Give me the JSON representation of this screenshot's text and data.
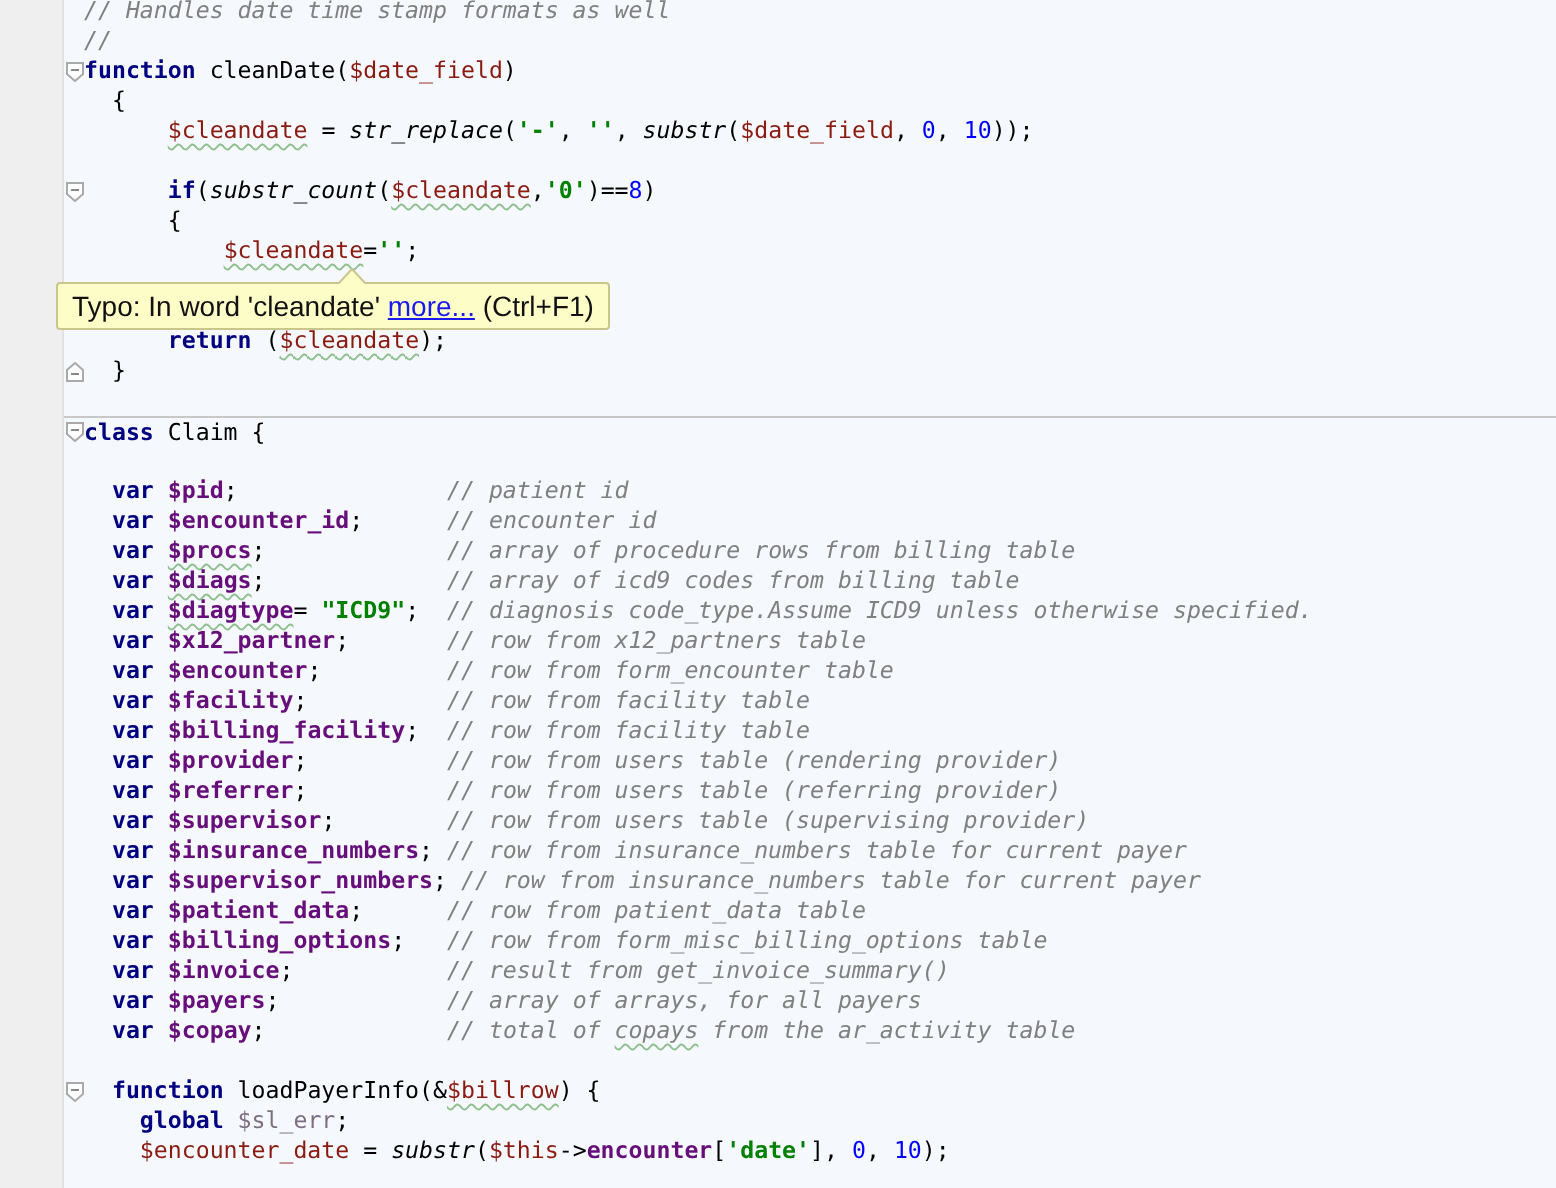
{
  "editor": {
    "lines": [
      {
        "kind": "code",
        "tokens": [
          {
            "kind": "comment",
            "text": "// Handles date time stamp formats as well"
          }
        ]
      },
      {
        "kind": "code",
        "tokens": [
          {
            "kind": "comment",
            "text": "//"
          }
        ]
      },
      {
        "kind": "fold-start",
        "tokens": [
          {
            "kind": "keyword",
            "text": "function"
          },
          {
            "kind": "text",
            "text": " cleanDate("
          },
          {
            "kind": "local",
            "text": "$date_field"
          },
          {
            "kind": "text",
            "text": ")"
          }
        ]
      },
      {
        "kind": "code",
        "tokens": [
          {
            "kind": "text",
            "text": "  {"
          }
        ]
      },
      {
        "kind": "code",
        "tokens": [
          {
            "kind": "local-typo",
            "text": "      $cleandate"
          },
          {
            "kind": "text",
            "text": " = "
          },
          {
            "kind": "call",
            "text": "str_replace"
          },
          {
            "kind": "text",
            "text": "("
          },
          {
            "kind": "string",
            "text": "'-'"
          },
          {
            "kind": "text",
            "text": ", "
          },
          {
            "kind": "string",
            "text": "''"
          },
          {
            "kind": "text",
            "text": ", "
          },
          {
            "kind": "call",
            "text": "substr"
          },
          {
            "kind": "text",
            "text": "("
          },
          {
            "kind": "local",
            "text": "$date_field"
          },
          {
            "kind": "text",
            "text": ", "
          },
          {
            "kind": "number",
            "text": "0"
          },
          {
            "kind": "text",
            "text": ", "
          },
          {
            "kind": "number",
            "text": "10"
          },
          {
            "kind": "text",
            "text": "));"
          }
        ]
      },
      {
        "kind": "blank"
      },
      {
        "kind": "fold-start",
        "tokens": [
          {
            "kind": "keyword",
            "text": "      if"
          },
          {
            "kind": "text",
            "text": "("
          },
          {
            "kind": "call",
            "text": "substr_count"
          },
          {
            "kind": "text",
            "text": "("
          },
          {
            "kind": "local-typo",
            "text": "$cleandate"
          },
          {
            "kind": "text",
            "text": ","
          },
          {
            "kind": "string",
            "text": "'0'"
          },
          {
            "kind": "text",
            "text": ")=="
          },
          {
            "kind": "number",
            "text": "8"
          },
          {
            "kind": "text",
            "text": ")"
          }
        ]
      },
      {
        "kind": "code",
        "tokens": [
          {
            "kind": "text",
            "text": "      {"
          }
        ]
      },
      {
        "kind": "code",
        "tokens": [
          {
            "kind": "local-typo",
            "text": "          $cleandate"
          },
          {
            "kind": "text",
            "text": "="
          },
          {
            "kind": "string",
            "text": "''"
          },
          {
            "kind": "text",
            "text": ";"
          }
        ]
      },
      {
        "kind": "blank"
      },
      {
        "kind": "blank"
      },
      {
        "kind": "code",
        "tokens": [
          {
            "kind": "keyword",
            "text": "      return"
          },
          {
            "kind": "text",
            "text": " ("
          },
          {
            "kind": "local-typo",
            "text": "$cleandate"
          },
          {
            "kind": "text",
            "text": ");"
          }
        ]
      },
      {
        "kind": "fold-end",
        "tokens": [
          {
            "kind": "text",
            "text": "  }"
          }
        ]
      },
      {
        "kind": "blank"
      },
      {
        "kind": "fold-start",
        "separator_above": true,
        "tokens": [
          {
            "kind": "keyword",
            "text": "class"
          },
          {
            "kind": "text",
            "text": " Claim {"
          }
        ]
      },
      {
        "kind": "blank"
      },
      {
        "kind": "code",
        "tokens": [
          {
            "kind": "keyword",
            "text": "  var"
          },
          {
            "kind": "field",
            "text": " $pid"
          },
          {
            "kind": "text",
            "text": ";"
          },
          {
            "kind": "comment",
            "text": "               // patient id"
          }
        ]
      },
      {
        "kind": "code",
        "tokens": [
          {
            "kind": "keyword",
            "text": "  var"
          },
          {
            "kind": "field",
            "text": " $encounter_id"
          },
          {
            "kind": "text",
            "text": ";"
          },
          {
            "kind": "comment",
            "text": "      // encounter id"
          }
        ]
      },
      {
        "kind": "code",
        "tokens": [
          {
            "kind": "keyword",
            "text": "  var"
          },
          {
            "kind": "field-typo",
            "text": " $procs"
          },
          {
            "kind": "text",
            "text": ";"
          },
          {
            "kind": "comment",
            "text": "             // array of procedure rows from billing table"
          }
        ]
      },
      {
        "kind": "code",
        "tokens": [
          {
            "kind": "keyword",
            "text": "  var"
          },
          {
            "kind": "field-typo",
            "text": " $diags"
          },
          {
            "kind": "text",
            "text": ";"
          },
          {
            "kind": "comment",
            "text": "             // array of icd9 codes from billing table"
          }
        ]
      },
      {
        "kind": "code",
        "tokens": [
          {
            "kind": "keyword",
            "text": "  var"
          },
          {
            "kind": "field-typo",
            "text": " $diagtype"
          },
          {
            "kind": "text",
            "text": "="
          },
          {
            "kind": "string",
            "text": " \"ICD9\""
          },
          {
            "kind": "text",
            "text": ";"
          },
          {
            "kind": "comment",
            "text": "  // diagnosis code_type.Assume ICD9 unless otherwise specified."
          }
        ]
      },
      {
        "kind": "code",
        "tokens": [
          {
            "kind": "keyword",
            "text": "  var"
          },
          {
            "kind": "field",
            "text": " $x12_partner"
          },
          {
            "kind": "text",
            "text": ";"
          },
          {
            "kind": "comment",
            "text": "       // row from x12_partners table"
          }
        ]
      },
      {
        "kind": "code",
        "tokens": [
          {
            "kind": "keyword",
            "text": "  var"
          },
          {
            "kind": "field",
            "text": " $encounter"
          },
          {
            "kind": "text",
            "text": ";"
          },
          {
            "kind": "comment",
            "text": "         // row from form_encounter table"
          }
        ]
      },
      {
        "kind": "code",
        "tokens": [
          {
            "kind": "keyword",
            "text": "  var"
          },
          {
            "kind": "field",
            "text": " $facility"
          },
          {
            "kind": "text",
            "text": ";"
          },
          {
            "kind": "comment",
            "text": "          // row from facility table"
          }
        ]
      },
      {
        "kind": "code",
        "tokens": [
          {
            "kind": "keyword",
            "text": "  var"
          },
          {
            "kind": "field",
            "text": " $billing_facility"
          },
          {
            "kind": "text",
            "text": ";"
          },
          {
            "kind": "comment",
            "text": "  // row from facility table"
          }
        ]
      },
      {
        "kind": "code",
        "tokens": [
          {
            "kind": "keyword",
            "text": "  var"
          },
          {
            "kind": "field",
            "text": " $provider"
          },
          {
            "kind": "text",
            "text": ";"
          },
          {
            "kind": "comment",
            "text": "          // row from users table (rendering provider)"
          }
        ]
      },
      {
        "kind": "code",
        "tokens": [
          {
            "kind": "keyword",
            "text": "  var"
          },
          {
            "kind": "field",
            "text": " $referrer"
          },
          {
            "kind": "text",
            "text": ";"
          },
          {
            "kind": "comment",
            "text": "          // row from users table (referring provider)"
          }
        ]
      },
      {
        "kind": "code",
        "tokens": [
          {
            "kind": "keyword",
            "text": "  var"
          },
          {
            "kind": "field",
            "text": " $supervisor"
          },
          {
            "kind": "text",
            "text": ";"
          },
          {
            "kind": "comment",
            "text": "        // row from users table (supervising provider)"
          }
        ]
      },
      {
        "kind": "code",
        "tokens": [
          {
            "kind": "keyword",
            "text": "  var"
          },
          {
            "kind": "field",
            "text": " $insurance_numbers"
          },
          {
            "kind": "text",
            "text": ";"
          },
          {
            "kind": "comment",
            "text": " // row from insurance_numbers table for current payer"
          }
        ]
      },
      {
        "kind": "code",
        "tokens": [
          {
            "kind": "keyword",
            "text": "  var"
          },
          {
            "kind": "field",
            "text": " $supervisor_numbers"
          },
          {
            "kind": "text",
            "text": ";"
          },
          {
            "kind": "comment",
            "text": " // row from insurance_numbers table for current payer"
          }
        ]
      },
      {
        "kind": "code",
        "tokens": [
          {
            "kind": "keyword",
            "text": "  var"
          },
          {
            "kind": "field",
            "text": " $patient_data"
          },
          {
            "kind": "text",
            "text": ";"
          },
          {
            "kind": "comment",
            "text": "      // row from patient_data table"
          }
        ]
      },
      {
        "kind": "code",
        "tokens": [
          {
            "kind": "keyword",
            "text": "  var"
          },
          {
            "kind": "field",
            "text": " $billing_options"
          },
          {
            "kind": "text",
            "text": ";"
          },
          {
            "kind": "comment",
            "text": "   // row from form_misc_billing_options table"
          }
        ]
      },
      {
        "kind": "code",
        "tokens": [
          {
            "kind": "keyword",
            "text": "  var"
          },
          {
            "kind": "field",
            "text": " $invoice"
          },
          {
            "kind": "text",
            "text": ";"
          },
          {
            "kind": "comment",
            "text": "           // result from get_invoice_summary()"
          }
        ]
      },
      {
        "kind": "code",
        "tokens": [
          {
            "kind": "keyword",
            "text": "  var"
          },
          {
            "kind": "field",
            "text": " $payers"
          },
          {
            "kind": "text",
            "text": ";"
          },
          {
            "kind": "comment",
            "text": "            // array of arrays, for all payers"
          }
        ]
      },
      {
        "kind": "code",
        "tokens": [
          {
            "kind": "keyword",
            "text": "  var"
          },
          {
            "kind": "field",
            "text": " $copay"
          },
          {
            "kind": "text",
            "text": ";"
          },
          {
            "kind": "comment",
            "text": "             // total of"
          },
          {
            "kind": "comment-typo",
            "text": " copays"
          },
          {
            "kind": "comment",
            "text": " from the ar_activity table"
          }
        ]
      },
      {
        "kind": "blank"
      },
      {
        "kind": "fold-start",
        "tokens": [
          {
            "kind": "keyword",
            "text": "  function"
          },
          {
            "kind": "text",
            "text": " loadPayerInfo(&"
          },
          {
            "kind": "local-typo",
            "text": "$billrow"
          },
          {
            "kind": "text",
            "text": ") {"
          }
        ]
      },
      {
        "kind": "code",
        "tokens": [
          {
            "kind": "keyword",
            "text": "    global"
          },
          {
            "kind": "unused",
            "text": " $sl_err"
          },
          {
            "kind": "text",
            "text": ";"
          }
        ]
      },
      {
        "kind": "code",
        "tokens": [
          {
            "kind": "local",
            "text": "    $encounter_date"
          },
          {
            "kind": "text",
            "text": " = "
          },
          {
            "kind": "call",
            "text": "substr"
          },
          {
            "kind": "text",
            "text": "("
          },
          {
            "kind": "local",
            "text": "$this"
          },
          {
            "kind": "text",
            "text": "->"
          },
          {
            "kind": "member",
            "text": "encounter"
          },
          {
            "kind": "text",
            "text": "["
          },
          {
            "kind": "string",
            "text": "'date'"
          },
          {
            "kind": "text",
            "text": "], "
          },
          {
            "kind": "number",
            "text": "0"
          },
          {
            "kind": "text",
            "text": ", "
          },
          {
            "kind": "number",
            "text": "10"
          },
          {
            "kind": "text",
            "text": ");"
          }
        ]
      }
    ]
  },
  "tooltip": {
    "text": "Typo: In word 'cleandate' ",
    "link": "more...",
    "shortcut": " (Ctrl+F1)"
  }
}
